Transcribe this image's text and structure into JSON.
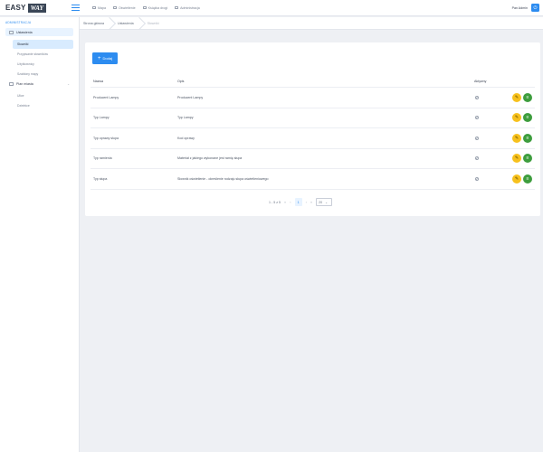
{
  "header": {
    "logo_left": "EASY",
    "logo_right": "WAY",
    "nav": [
      {
        "label": "Mapa",
        "icon": "map-icon"
      },
      {
        "label": "Oświetlenie",
        "icon": "lamp-icon"
      },
      {
        "label": "Książka drogi",
        "icon": "book-icon"
      },
      {
        "label": "Administracja",
        "icon": "admin-icon"
      }
    ],
    "user_name": "Pan Admin",
    "power_icon": "⏻"
  },
  "sidebar": {
    "section_title": "ADMINISTRACJA",
    "groups": [
      {
        "label": "Ustawienia",
        "children": [
          "Słowniki",
          "Przypisanie słowników",
          "Użytkownicy",
          "Szablony mapy"
        ]
      },
      {
        "label": "Plan miasta",
        "children": [
          "Ulice",
          "Dzielnice"
        ]
      }
    ]
  },
  "breadcrumb": [
    "Strona główna",
    "Ustawienia",
    "Słowniki"
  ],
  "toolbar": {
    "add_label": "Dodaj",
    "add_icon": "+"
  },
  "table": {
    "columns": [
      "Nazwa",
      "Opis",
      "Aktywny"
    ],
    "rows": [
      {
        "name": "Producent Lampy",
        "desc": "Producent Lampy"
      },
      {
        "name": "Typ Lampy",
        "desc": "Typ Lampy"
      },
      {
        "name": "Typ oprawy słupa",
        "desc": "Kod oprawy"
      },
      {
        "name": "Typ ramienia",
        "desc": "Materiał z jakiego wykonane jest ramię słupa"
      },
      {
        "name": "Typ słupa",
        "desc": "Słownik oświetlenie - określenie rodzaju słupa oświetleniowego"
      }
    ],
    "check_glyph": "✓",
    "edit_glyph": "✎",
    "list_glyph": "≡"
  },
  "pagination": {
    "range": "1 - 5 z 5",
    "first": "«",
    "prev": "‹",
    "page": "1",
    "next": "›",
    "last": "»",
    "page_size": "20",
    "dropdown": "⌄"
  },
  "colors": {
    "accent": "#2d8cf0",
    "edit": "#f7c11d",
    "list": "#3d9d3d"
  }
}
